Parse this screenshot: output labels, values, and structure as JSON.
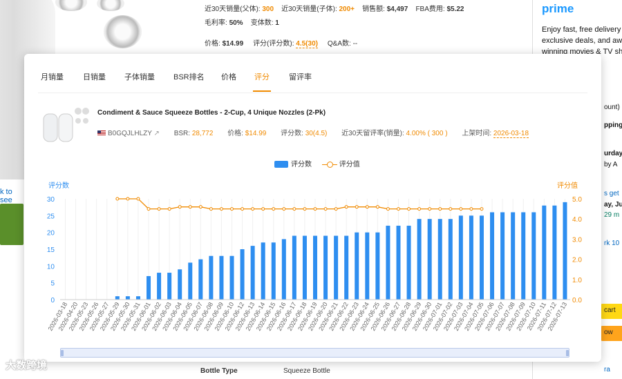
{
  "background": {
    "left_link_text": "k to see",
    "top_info": {
      "sales_parent_label": "近30天销量(父体): ",
      "sales_parent_value": "300",
      "sales_child_label": "近30天销量(子体): ",
      "sales_child_value": "200+",
      "revenue_label": "销售额: ",
      "revenue_value": "$4,497",
      "fba_label": "FBA费用: ",
      "fba_value": "$5.22",
      "margin_label": "毛利率: ",
      "margin_value": "50%",
      "variants_label": "变体数: ",
      "variants_value": "1",
      "price_label": "价格: ",
      "price_value": "$14.99",
      "rating_label": "评分(评分数): ",
      "rating_value": "4.5(30)",
      "qa_label": "Q&A数: ",
      "qa_value": "--"
    },
    "right_panel": {
      "prime_logo": "prime",
      "prime_text": [
        "Enjoy fast, free delivery",
        "exclusive deals, and aw",
        "winning movies & TV sh"
      ],
      "lines": [
        "ount)",
        "pping",
        "urday",
        "by A",
        "s get",
        "ay, Ju",
        "29 m",
        "rk 10"
      ],
      "cart_label": "cart",
      "buy_label": "ow",
      "bottom_link": "ra"
    },
    "bottle_type_label": "Bottle Type",
    "bottle_type_value": "Squeeze Bottle",
    "watermark": "大数跨境"
  },
  "tabs": [
    "月销量",
    "日销量",
    "子体销量",
    "BSR排名",
    "价格",
    "评分",
    "留评率"
  ],
  "active_tab": "评分",
  "product": {
    "title": "Condiment & Sauce Squeeze Bottles - 2-Cup, 4 Unique Nozzles (2-Pk)",
    "asin": "B0GQJLHLZY",
    "bsr_label": "BSR: ",
    "bsr_value": "28,772",
    "price_label": "价格: ",
    "price_value": "$14.99",
    "rating_count_label": "评分数: ",
    "rating_count_value": "30(4.5)",
    "review_rate_label": "近30天留评率(销量): ",
    "review_rate_value": "4.00% ( 300 )",
    "launch_label": "上架时间: ",
    "launch_value": "2026-03-18"
  },
  "chart_data": {
    "type": "bar",
    "legend": [
      "评分数",
      "评分值"
    ],
    "left_axis_label": "评分数",
    "right_axis_label": "评分值",
    "left_ticks": [
      "0",
      "5",
      "10",
      "15",
      "20",
      "25",
      "30"
    ],
    "right_ticks": [
      "0.0",
      "1.0",
      "2.0",
      "3.0",
      "4.0",
      "5.0"
    ],
    "ylim_left": [
      0,
      30
    ],
    "ylim_right": [
      0,
      5
    ],
    "categories": [
      "2026-03-18",
      "2026-04-20",
      "2026-05-23",
      "2026-05-26",
      "2026-05-27",
      "2026-05-29",
      "2026-05-30",
      "2026-05-31",
      "2026-06-01",
      "2026-06-02",
      "2026-06-03",
      "2026-06-04",
      "2026-06-05",
      "2026-06-07",
      "2026-06-08",
      "2026-06-09",
      "2026-06-10",
      "2026-06-12",
      "2026-06-13",
      "2026-06-14",
      "2026-06-15",
      "2026-06-16",
      "2026-06-17",
      "2026-06-18",
      "2026-06-19",
      "2026-06-20",
      "2026-06-21",
      "2026-06-22",
      "2026-06-23",
      "2026-06-24",
      "2026-06-25",
      "2026-06-26",
      "2026-06-27",
      "2026-06-28",
      "2026-06-29",
      "2026-06-30",
      "2026-07-01",
      "2026-07-02",
      "2026-07-03",
      "2026-07-04",
      "2026-07-05",
      "2026-07-06",
      "2026-07-07",
      "2026-07-08",
      "2026-07-09",
      "2026-07-10",
      "2026-07-11",
      "2026-07-12",
      "2026-07-13"
    ],
    "series": [
      {
        "name": "评分数",
        "values": [
          0,
          0,
          0,
          0,
          0,
          1,
          1,
          1,
          7,
          8,
          8,
          9,
          11,
          12,
          13,
          13,
          13,
          15,
          16,
          17,
          17,
          18,
          19,
          19,
          19,
          19,
          19,
          19,
          20,
          20,
          20,
          22,
          22,
          22,
          24,
          24,
          24,
          24,
          25,
          25,
          25,
          26,
          26,
          26,
          26,
          26,
          28,
          28,
          29
        ]
      },
      {
        "name": "评分值",
        "values": [
          null,
          null,
          null,
          null,
          null,
          5.0,
          5.0,
          5.0,
          4.5,
          4.5,
          4.5,
          4.6,
          4.6,
          4.6,
          4.5,
          4.5,
          4.5,
          4.5,
          4.5,
          4.5,
          4.5,
          4.5,
          4.5,
          4.5,
          4.5,
          4.5,
          4.5,
          4.6,
          4.6,
          4.6,
          4.6,
          4.5,
          4.5,
          4.5,
          4.5,
          4.5,
          4.5,
          4.5,
          4.5,
          4.5,
          4.5,
          null,
          null,
          null,
          null,
          null,
          null,
          null,
          null
        ]
      }
    ]
  },
  "colors": {
    "bar": "#2e8ef0",
    "line": "#f08a00",
    "accent": "#f08a00"
  }
}
